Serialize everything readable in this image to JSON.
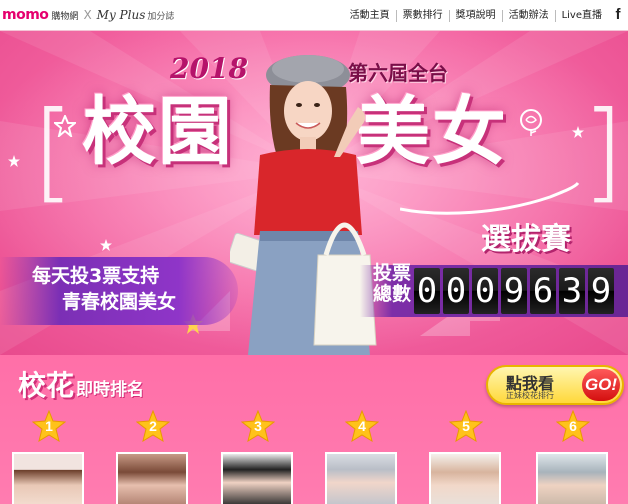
{
  "nav": {
    "brand": {
      "momo": "momo",
      "momo_sub": "購物網",
      "x": "X",
      "myplus": "My Plus",
      "myplus_sub": "加分誌"
    },
    "links": [
      "活動主頁",
      "票數排行",
      "獎項說明",
      "活動辦法",
      "Live直播"
    ],
    "facebook_icon": "f"
  },
  "hero": {
    "year": "2018",
    "edition": "第六屆全台",
    "title_left": "校園",
    "title_right": "美女",
    "subtitle": "選拔賽",
    "slogan_line1": "每天投3票支持",
    "slogan_line2": "青春校園美女",
    "counter_label": "投票總數",
    "counter_digits": [
      "0",
      "0",
      "0",
      "9",
      "6",
      "3",
      "9"
    ]
  },
  "ranking": {
    "title_main": "校花",
    "title_sub": "即時排名",
    "button_main": "點我看",
    "button_sub": "正妹校花排行",
    "button_go": "GO!",
    "ranks": [
      "1",
      "2",
      "3",
      "4",
      "5",
      "6"
    ]
  },
  "colors": {
    "accent": "#e5006e",
    "hero_bg": "#f66aa6",
    "counter_bg": "#6a2694",
    "button_yellow": "#ffd83a"
  }
}
